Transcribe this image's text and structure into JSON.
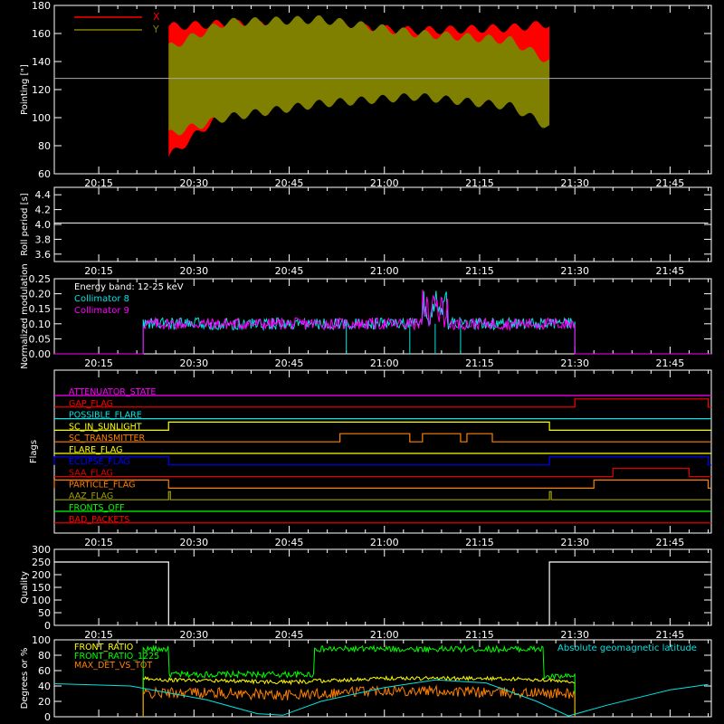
{
  "time_ticks": [
    "20:15",
    "20:30",
    "20:45",
    "21:00",
    "21:15",
    "21:30",
    "21:45"
  ],
  "colors": {
    "x": "#ff0000",
    "y": "#808000",
    "white": "#ffffff",
    "cyan": "#00e5e5",
    "magenta": "#ff00ff",
    "yellow": "#ffff00",
    "orange": "#ff8000",
    "green": "#00ff00",
    "blue": "#0000ff",
    "red": "#e00000",
    "olive": "#a0a000"
  },
  "chart_data": [
    {
      "type": "area",
      "ylabel": "Pointing [\"]",
      "ylim": [
        60,
        180
      ],
      "yticks": [
        60,
        80,
        100,
        120,
        140,
        160,
        180
      ],
      "legend": [
        "X",
        "Y"
      ],
      "reference_line": 128,
      "series": [
        {
          "name": "X",
          "x": [
            "20:26",
            "20:35",
            "20:50",
            "21:05",
            "21:20",
            "21:26"
          ],
          "upper": [
            165,
            167,
            165,
            162,
            164,
            167
          ],
          "lower": [
            72,
            105,
            118,
            123,
            120,
            105
          ]
        },
        {
          "name": "Y",
          "x": [
            "20:26",
            "20:35",
            "20:50",
            "21:05",
            "21:20",
            "21:26"
          ],
          "upper": [
            150,
            168,
            170,
            160,
            155,
            140
          ],
          "lower": [
            88,
            100,
            110,
            115,
            108,
            93
          ]
        }
      ]
    },
    {
      "type": "line",
      "ylabel": "Roll period [s]",
      "ylim": [
        3.5,
        4.5
      ],
      "yticks": [
        3.6,
        3.8,
        4.0,
        4.2,
        4.4
      ],
      "series": [
        {
          "x": [
            "20:08",
            "21:51"
          ],
          "y": [
            4.02,
            4.02
          ]
        }
      ]
    },
    {
      "type": "line",
      "ylabel": "Normalized modulation",
      "ylim": [
        0,
        0.25
      ],
      "yticks": [
        0.0,
        0.05,
        0.1,
        0.15,
        0.2,
        0.25
      ],
      "annotation": "Energy band: 12-25 keV",
      "legend": [
        "Collimator 8",
        "Collimator 9"
      ],
      "start": "20:22",
      "end": "21:30",
      "baseline": 0.1
    },
    {
      "type": "line",
      "ylabel": "Flags",
      "flags": [
        {
          "name": "ATTENUATOR_STATE",
          "color": "#ff00ff",
          "steps": []
        },
        {
          "name": "GAP_FLAG",
          "color": "#ff0000",
          "steps": [
            [
              "21:30",
              "21:51"
            ]
          ]
        },
        {
          "name": "POSSIBLE_FLARE",
          "color": "#00e5e5",
          "steps": []
        },
        {
          "name": "SC_IN_SUNLIGHT",
          "color": "#ffff00",
          "steps": [
            [
              "20:26",
              "21:26"
            ]
          ]
        },
        {
          "name": "SC_TRANSMITTER",
          "color": "#ff8000",
          "steps": [
            [
              "20:53",
              "21:04"
            ],
            [
              "21:06",
              "21:12"
            ],
            [
              "21:13",
              "21:17"
            ]
          ]
        },
        {
          "name": "FLARE_FLAG",
          "color": "#ffff00",
          "steps": []
        },
        {
          "name": "ECLIPSE_FLAG",
          "color": "#0000ff",
          "steps": [
            [
              "20:08",
              "20:26"
            ],
            [
              "21:26",
              "21:51"
            ]
          ]
        },
        {
          "name": "SAA_FLAG",
          "color": "#e00000",
          "steps": [
            [
              "21:36",
              "21:48"
            ]
          ]
        },
        {
          "name": "PARTICLE_FLAG",
          "color": "#ff8000",
          "steps": [
            [
              "20:08",
              "20:26"
            ],
            [
              "21:33",
              "21:51"
            ]
          ]
        },
        {
          "name": "AAZ_FLAG",
          "color": "#a0a000",
          "steps": [
            [
              "20:26",
              "20:26"
            ],
            [
              "21:26",
              "21:26"
            ]
          ]
        },
        {
          "name": "FRONTS_OFF",
          "color": "#00ff00",
          "steps": []
        },
        {
          "name": "BAD_PACKETS",
          "color": "#ff0000",
          "steps": []
        }
      ]
    },
    {
      "type": "line",
      "ylabel": "Quality",
      "ylim": [
        0,
        300
      ],
      "yticks": [
        0,
        50,
        100,
        150,
        200,
        250,
        300
      ],
      "series": [
        {
          "x": [
            "20:08",
            "20:26",
            "20:26",
            "21:26",
            "21:26",
            "21:51"
          ],
          "y": [
            250,
            250,
            0,
            0,
            250,
            250
          ]
        }
      ]
    },
    {
      "type": "line",
      "ylabel": "Degrees or %",
      "ylim": [
        0,
        100
      ],
      "yticks": [
        0,
        20,
        40,
        60,
        80,
        100
      ],
      "legend": [
        "FRONT_RATIO",
        "FRONT_RATIO_1225",
        "MAX_DET_VS_TOT"
      ],
      "annotation": "Absolute geomagnetic latitude",
      "series": [
        {
          "name": "FRONT_RATIO",
          "x": [
            "20:22",
            "20:26",
            "20:45",
            "21:00",
            "21:15",
            "21:26",
            "21:30"
          ],
          "y": [
            50,
            48,
            45,
            50,
            50,
            48,
            45
          ]
        },
        {
          "name": "FRONT_RATIO_1225",
          "x": [
            "20:22",
            "20:26",
            "20:45",
            "21:00",
            "21:15",
            "21:26",
            "21:30"
          ],
          "y": [
            88,
            50,
            48,
            90,
            85,
            58,
            50
          ]
        },
        {
          "name": "MAX_DET_VS_TOT",
          "x": [
            "20:22",
            "20:30",
            "20:45",
            "21:00",
            "21:15",
            "21:30"
          ],
          "y": [
            30,
            32,
            28,
            35,
            32,
            30
          ]
        },
        {
          "name": "Absolute geomagnetic latitude",
          "x": [
            "20:08",
            "20:30",
            "20:54",
            "21:15",
            "21:29",
            "21:51"
          ],
          "y": [
            45,
            25,
            45,
            48,
            0,
            42
          ]
        }
      ]
    }
  ]
}
